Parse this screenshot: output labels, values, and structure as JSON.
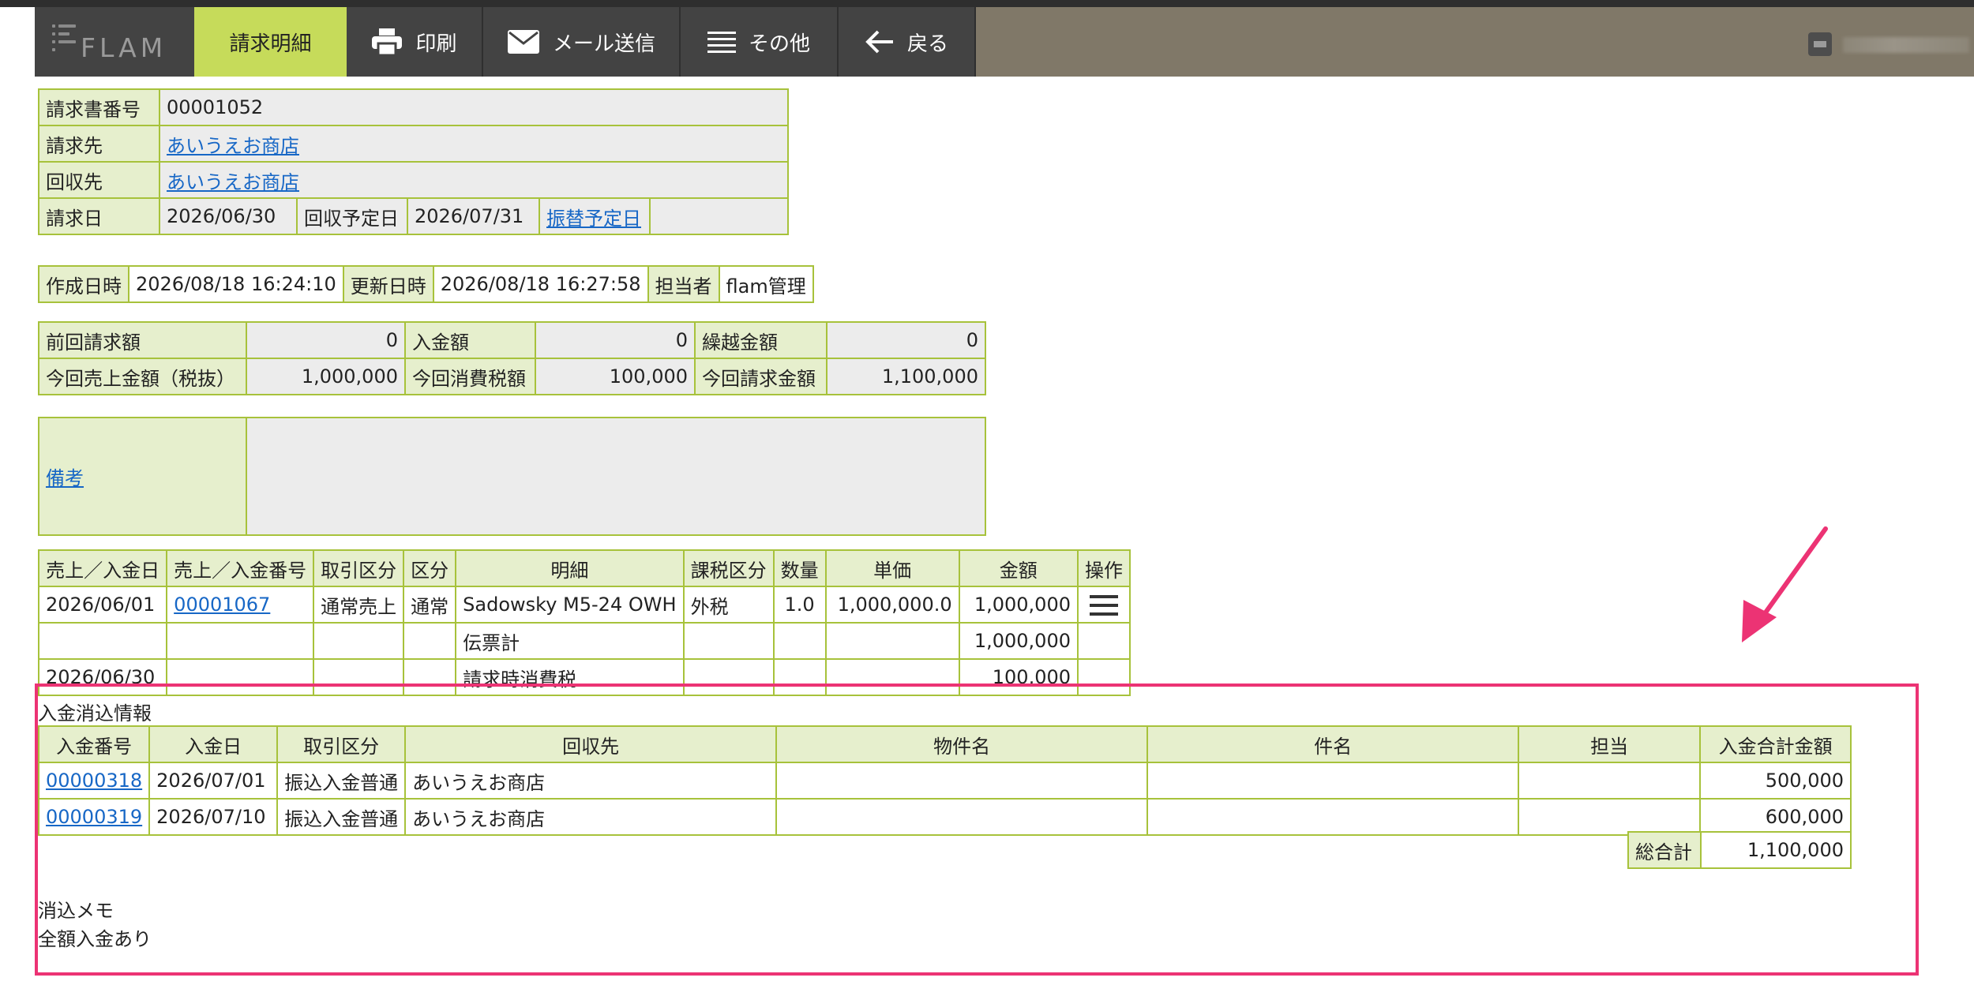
{
  "app": {
    "logo_text": "FLAM"
  },
  "nav": {
    "items": [
      {
        "label": "請求明細",
        "icon": "none",
        "active": true
      },
      {
        "label": "印刷",
        "icon": "printer-icon",
        "active": false
      },
      {
        "label": "メール送信",
        "icon": "envelope-icon",
        "active": false
      },
      {
        "label": "その他",
        "icon": "menu-icon",
        "active": false
      },
      {
        "label": "戻る",
        "icon": "arrow-left-icon",
        "active": false
      }
    ]
  },
  "invoice": {
    "number_label": "請求書番号",
    "number": "00001052",
    "billing_to_label": "請求先",
    "billing_to": "あいうえお商店",
    "collect_from_label": "回収先",
    "collect_from": "あいうえお商店",
    "invoice_date_label": "請求日",
    "invoice_date": "2026/06/30",
    "collect_date_label": "回収予定日",
    "collect_date": "2026/07/31",
    "transfer_date_link": "振替予定日"
  },
  "meta": {
    "created_label": "作成日時",
    "created": "2026/08/18 16:24:10",
    "updated_label": "更新日時",
    "updated": "2026/08/18 16:27:58",
    "staff_label": "担当者",
    "staff": "flam管理"
  },
  "amounts": {
    "prev_label": "前回請求額",
    "prev": "0",
    "received_label": "入金額",
    "received": "0",
    "carryover_label": "繰越金額",
    "carryover": "0",
    "sales_label": "今回売上金額（税抜）",
    "sales": "1,000,000",
    "tax_label": "今回消費税額",
    "tax": "100,000",
    "total_label": "今回請求金額",
    "total": "1,100,000"
  },
  "remarks": {
    "label": "備考",
    "value": ""
  },
  "details": {
    "headers": [
      "売上／入金日",
      "売上／入金番号",
      "取引区分",
      "区分",
      "明細",
      "課税区分",
      "数量",
      "単価",
      "金額",
      "操作"
    ],
    "rows": [
      {
        "date": "2026/06/01",
        "number": "00001067",
        "trade_type": "通常売上",
        "category": "通常",
        "item": "Sadowsky M5-24 OWH",
        "tax_type": "外税",
        "qty": "1.0",
        "unit_price": "1,000,000.0",
        "amount": "1,000,000",
        "has_menu": true
      },
      {
        "date": "",
        "number": "",
        "trade_type": "",
        "category": "",
        "item": "伝票計",
        "tax_type": "",
        "qty": "",
        "unit_price": "",
        "amount": "1,000,000",
        "has_menu": false
      },
      {
        "date": "2026/06/30",
        "number": "",
        "trade_type": "",
        "category": "",
        "item": "請求時消費税",
        "tax_type": "",
        "qty": "",
        "unit_price": "",
        "amount": "100,000",
        "has_menu": false
      }
    ]
  },
  "payment_clearing": {
    "title": "入金消込情報",
    "headers": [
      "入金番号",
      "入金日",
      "取引区分",
      "回収先",
      "物件名",
      "件名",
      "担当",
      "入金合計金額"
    ],
    "rows": [
      {
        "number": "00000318",
        "date": "2026/07/01",
        "trade_type": "振込入金普通",
        "collect_from": "あいうえお商店",
        "property": "",
        "subject": "",
        "staff": "",
        "amount": "500,000"
      },
      {
        "number": "00000319",
        "date": "2026/07/10",
        "trade_type": "振込入金普通",
        "collect_from": "あいうえお商店",
        "property": "",
        "subject": "",
        "staff": "",
        "amount": "600,000"
      }
    ],
    "grand_total_label": "総合計",
    "grand_total": "1,100,000",
    "memo_label": "消込メモ",
    "memo": "全額入金あり"
  },
  "colors": {
    "accent": "#c6db5a",
    "border": "#a7c23b",
    "label_bg": "#e6efcd",
    "highlight": "#ec3374",
    "link": "#1767c6"
  }
}
